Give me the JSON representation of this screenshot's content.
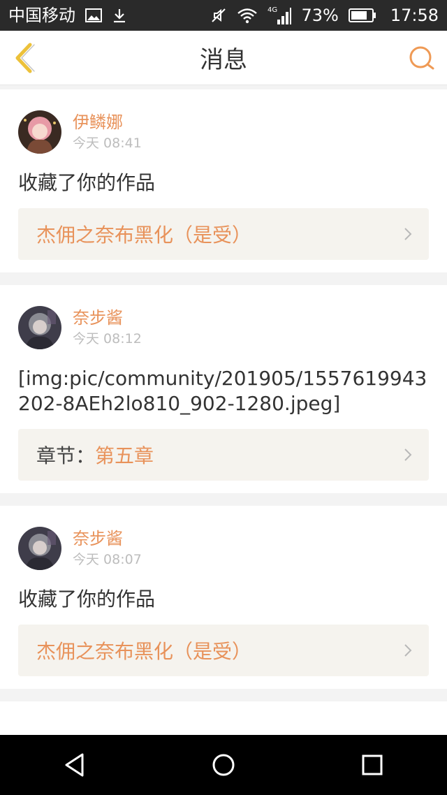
{
  "status_bar": {
    "carrier": "中国移动",
    "network": "4G",
    "battery_percent": "73%",
    "time": "17:58",
    "icons": [
      "image-icon",
      "download-icon",
      "mute-icon",
      "wifi-icon",
      "signal-icon",
      "battery-icon"
    ]
  },
  "nav": {
    "title": "消息",
    "back_icon": "back-chevron-icon",
    "search_icon": "search-icon"
  },
  "messages": [
    {
      "user": "伊鳞娜",
      "time": "今天 08:41",
      "text": "收藏了你的作品",
      "ref_label": "",
      "ref_title": "杰佣之奈布黑化（是受）"
    },
    {
      "user": "奈步酱",
      "time": "今天 08:12",
      "text": "[img:pic/community/201905/1557619943202-8AEh2lo810_902-1280.jpeg]",
      "ref_label": "章节：",
      "ref_title": "第五章"
    },
    {
      "user": "奈步酱",
      "time": "今天 08:07",
      "text": "收藏了你的作品",
      "ref_label": "",
      "ref_title": "杰佣之奈布黑化（是受）"
    }
  ],
  "colors": {
    "accent": "#e8925a",
    "status_bar_bg": "#2a2a2a",
    "ref_box_bg": "#f5f3ee"
  }
}
